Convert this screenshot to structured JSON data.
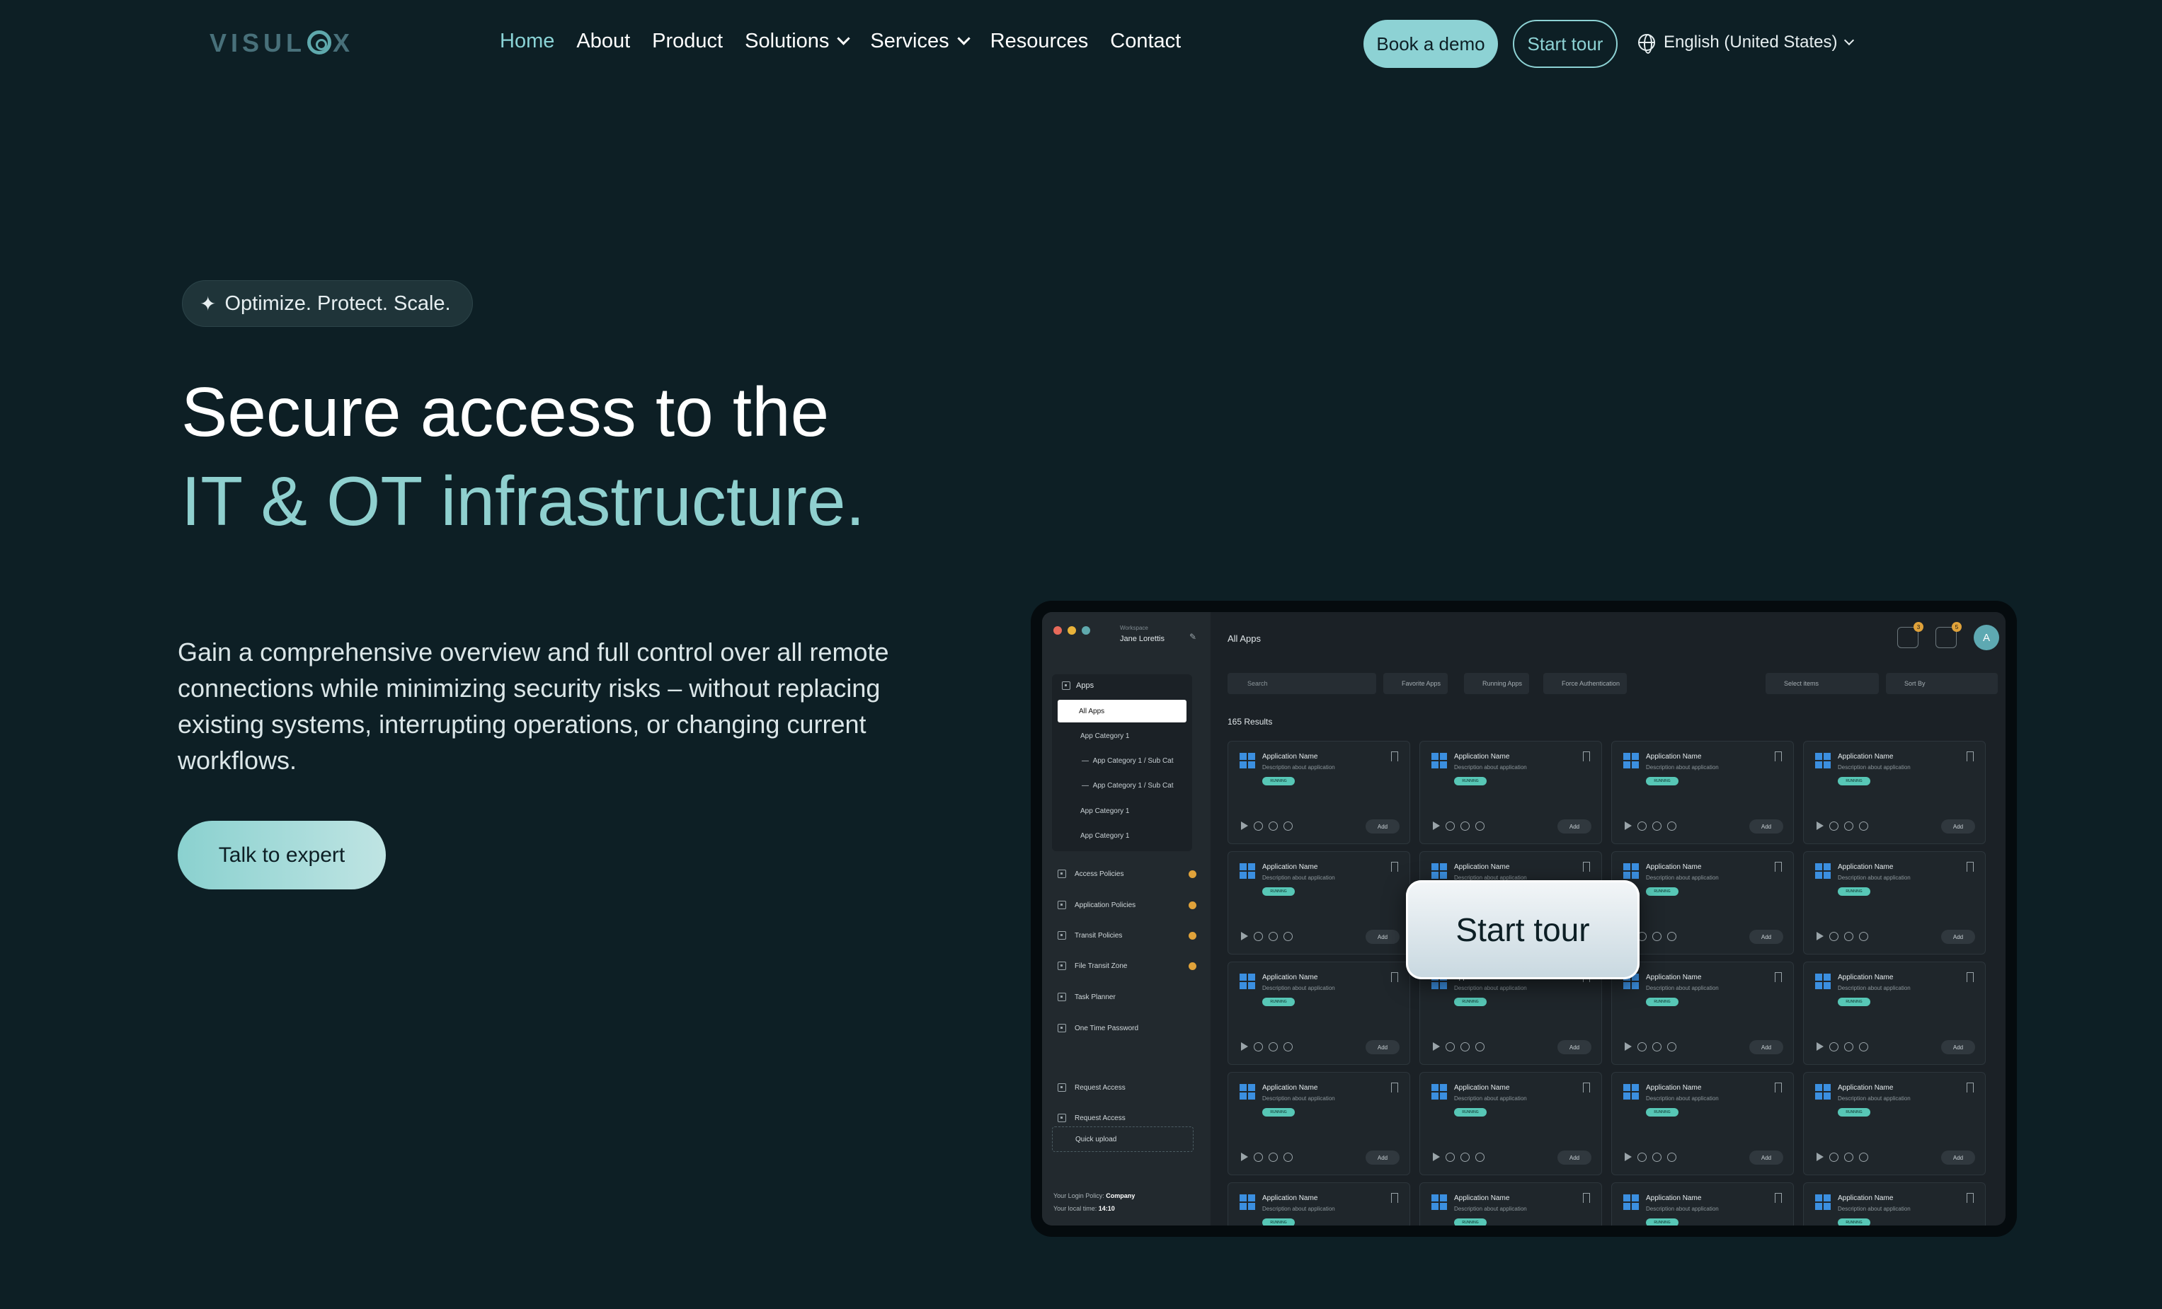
{
  "nav": {
    "logo": "VISULOX",
    "links": [
      {
        "label": "Home",
        "active": true
      },
      {
        "label": "About"
      },
      {
        "label": "Product"
      },
      {
        "label": "Solutions",
        "dropdown": true
      },
      {
        "label": "Services",
        "dropdown": true
      },
      {
        "label": "Resources"
      },
      {
        "label": "Contact"
      }
    ],
    "book_demo": "Book a demo",
    "start_tour": "Start tour",
    "language": "English (United States)"
  },
  "hero": {
    "badge": "Optimize. Protect. Scale.",
    "title_line1": "Secure access to the",
    "title_line2": "IT & OT infrastructure.",
    "description": "Gain a comprehensive overview and full control over all remote connections while minimizing security risks – without replacing existing systems, interrupting operations, or changing current workflows.",
    "cta": "Talk to expert"
  },
  "mockup": {
    "workspace_label": "Workspace",
    "workspace_name": "Jane Lorettis",
    "sidebar": {
      "apps": "Apps",
      "all_apps": "All Apps",
      "categories": [
        "App Category 1",
        "App Category 1 / Sub Cat",
        "App Category 1 / Sub Cat",
        "App Category 1",
        "App Category 1"
      ],
      "items": [
        "Access Policies",
        "Application Policies",
        "Transit Policies",
        "File Transit Zone",
        "Task Planner",
        "One Time Password"
      ],
      "bottom_items": [
        "Request Access",
        "Request Access"
      ],
      "quick_upload": "Quick upload",
      "login_policy_label": "Your Login Policy:",
      "login_policy_value": "Company",
      "local_time_label": "Your local time:",
      "local_time_value": "14:10"
    },
    "main_title": "All Apps",
    "notif_counts": [
      "3",
      "5"
    ],
    "avatar": "A",
    "search_placeholder": "Search",
    "filters": [
      "Favorite Apps",
      "Running Apps",
      "Force Authentication"
    ],
    "select_items": "Select items",
    "sort_by": "Sort By",
    "results": "165 Results",
    "card": {
      "name": "Application Name",
      "description": "Description about application",
      "status": "RUNNING",
      "add": "Add"
    }
  },
  "overlay_button": "Start tour",
  "colors": {
    "background": "#0d1f25",
    "accent": "#8dd2d4",
    "running": "#57c7b6",
    "warning": "#e0a23a"
  }
}
